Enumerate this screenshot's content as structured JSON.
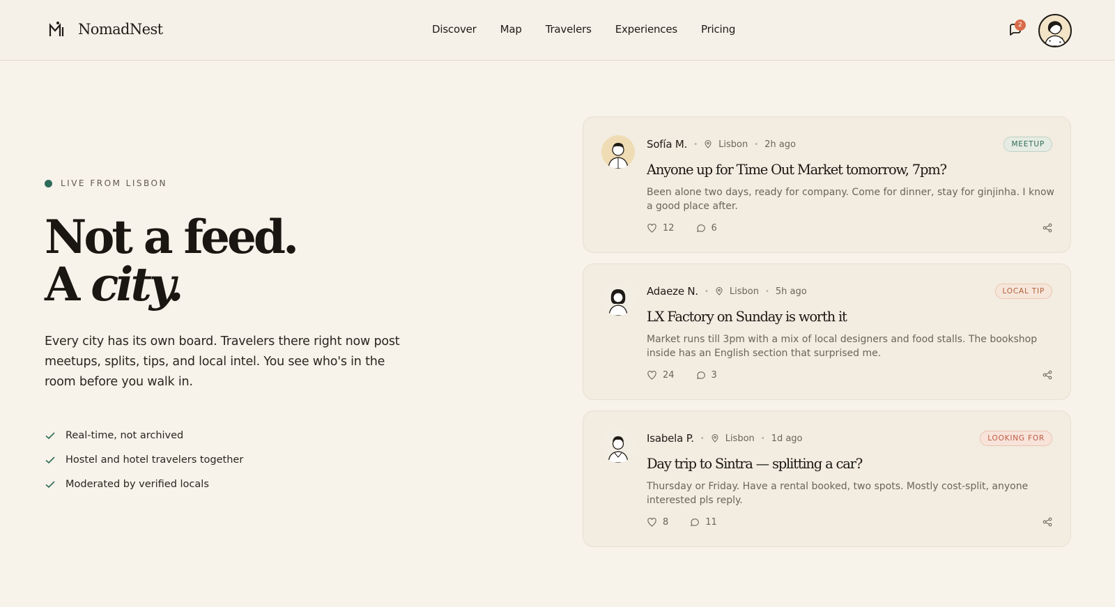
{
  "brand": {
    "name": "NomadNest"
  },
  "nav": [
    "Discover",
    "Map",
    "Travelers",
    "Experiences",
    "Pricing"
  ],
  "notifications": {
    "count": "2"
  },
  "hero": {
    "live_label": "LIVE FROM LISBON",
    "title_line1": "Not a feed.",
    "title_line2_prefix": "A ",
    "title_line2_italic": "city.",
    "body": "Every city has its own board. Travelers there right now post meetups, splits, tips, and local intel. You see who's in the room before you walk in.",
    "checks": [
      "Real-time, not archived",
      "Hostel and hotel travelers together",
      "Moderated by verified locals"
    ]
  },
  "posts": [
    {
      "author": "Sofía M.",
      "location": "Lisbon",
      "time": "2h ago",
      "tag": "MEETUP",
      "tag_color": "#2f6b5a",
      "tag_bg": "#e6ece3",
      "tag_border": "#bfd2c3",
      "title": "Anyone up for Time Out Market tomorrow, 7pm?",
      "body": "Been alone two days, ready for company. Come for dinner, stay for ginjinha. I know a good place after.",
      "likes": "12",
      "comments": "6"
    },
    {
      "author": "Adaeze N.",
      "location": "Lisbon",
      "time": "5h ago",
      "tag": "LOCAL TIP",
      "tag_color": "#b0603c",
      "tag_bg": "#f6e6da",
      "tag_border": "#ebc6b1",
      "title": "LX Factory on Sunday is worth it",
      "body": "Market runs till 3pm with a mix of local designers and food stalls. The bookshop inside has an English section that surprised me.",
      "likes": "24",
      "comments": "3"
    },
    {
      "author": "Isabela P.",
      "location": "Lisbon",
      "time": "1d ago",
      "tag": "LOOKING FOR",
      "tag_color": "#c05a44",
      "tag_bg": "#f7e3da",
      "tag_border": "#edc2b2",
      "title": "Day trip to Sintra — splitting a car?",
      "body": "Thursday or Friday. Have a rental booked, two spots. Mostly cost-split, anyone interested pls reply.",
      "likes": "8",
      "comments": "11"
    }
  ]
}
